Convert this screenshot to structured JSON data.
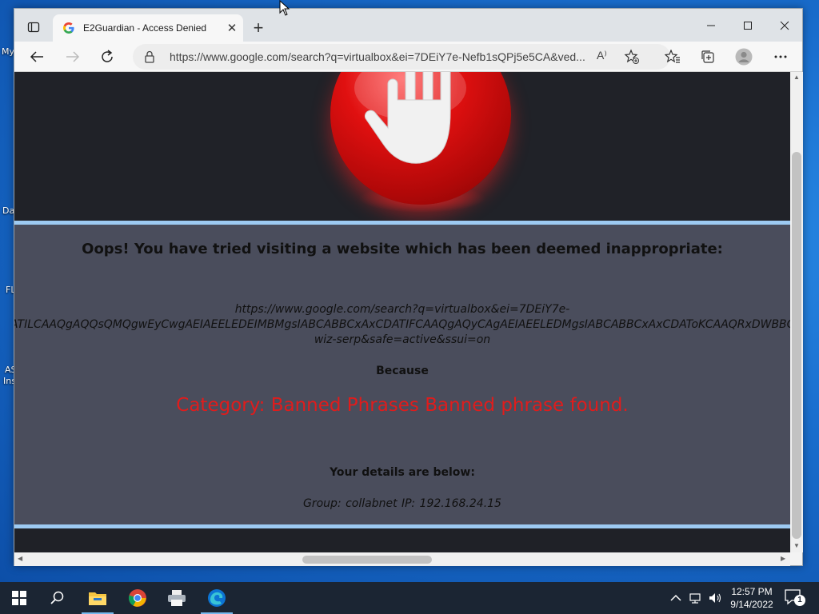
{
  "desktop": {
    "icon_labels": [
      "My",
      "Da",
      "FL",
      "AS",
      "Ins"
    ]
  },
  "browser": {
    "tab": {
      "title": "E2Guardian - Access Denied",
      "close": "✕"
    },
    "new_tab": "+",
    "window_controls": {
      "minimize": "—",
      "maximize": "☐",
      "close": "✕"
    },
    "address": {
      "url": "https://www.google.com/search?q=virtualbox&ei=7DEiY7e-Nefb1sQPj5e5CA&ved...",
      "read_aloud": "A⁾"
    }
  },
  "page": {
    "heading": "Oops! You have tried visiting a website which has been deemed inappropriate:",
    "blocked_url": {
      "line1": "https://www.google.com/search?q=virtualbox&ei=7DEiY7e-",
      "line2": "ATILCAAQgAQQsQMQgwEyCwgAEIAEELEDEIMBMgsIABCABBCxAxCDATIFCAAQgAQyCAgAEIAEELEDMgsIABCABBCxAxCDAToKCAAQRxDWBBCw",
      "line3": "wiz-serp&safe=active&ssui=on"
    },
    "because": "Because",
    "reason": "Category: Banned Phrases  Banned phrase found.",
    "details_heading": "Your details are below:",
    "details": "Group: collabnet   IP: 192.168.24.15"
  },
  "taskbar": {
    "time": "12:57 PM",
    "date": "9/14/2022",
    "notification_count": "1"
  },
  "colors": {
    "reason_red": "#e01c1c",
    "content_bg": "#4a4d5c",
    "banner_bg": "#202228",
    "rule_blue": "#9dcaf2"
  }
}
